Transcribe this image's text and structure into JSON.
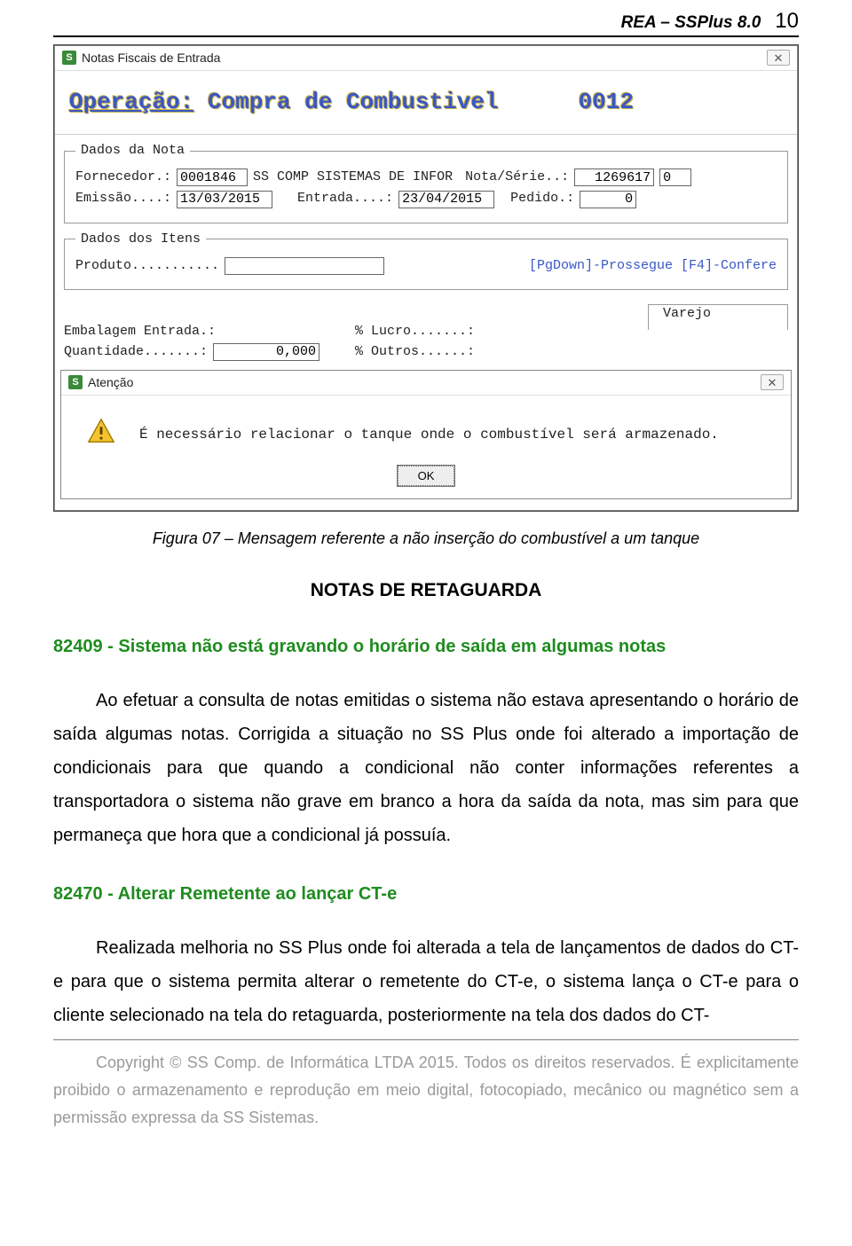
{
  "header": {
    "product": "REA – SSPlus 8.0",
    "page_number": "10"
  },
  "screenshot": {
    "main_window_title": "Notas Fiscais de Entrada",
    "close_glyph": "✕",
    "banner_op_label": "Operação:",
    "banner_op_value": "Compra de Combustivel",
    "banner_code": "0012",
    "group_nota": {
      "legend": "Dados da Nota",
      "fornecedor_label": "Fornecedor.:",
      "fornecedor_code": "0001846",
      "fornecedor_name": "SS COMP SISTEMAS DE INFOR",
      "nota_serie_label": "Nota/Série..:",
      "nota_value": "1269617",
      "serie_value": "0",
      "emissao_label": "Emissão....:",
      "emissao_value": "13/03/2015",
      "entrada_label": "Entrada....:",
      "entrada_value": "23/04/2015",
      "pedido_label": "Pedido.:",
      "pedido_value": "0"
    },
    "group_itens": {
      "legend": "Dados dos Itens",
      "produto_label": "Produto...........",
      "produto_value": "",
      "hints": "[PgDown]-Prossegue  [F4]-Confere"
    },
    "varejo_label": "Varejo",
    "fields2": {
      "embalagem_label": "Embalagem Entrada.:",
      "quantidade_label": "Quantidade.......:",
      "quantidade_value": "0,000",
      "lucro_label": "% Lucro.......:",
      "outros_label": "% Outros......:"
    },
    "dialog": {
      "title": "Atenção",
      "message": "É necessário relacionar o tanque onde o combustível será armazenado.",
      "ok": "OK"
    }
  },
  "caption": "Figura 07 – Mensagem referente a não inserção do combustível a um tanque",
  "section_title": "NOTAS DE RETAGUARDA",
  "item1": {
    "heading": "82409 - Sistema não está gravando o horário de saída em algumas notas",
    "body": "Ao efetuar a consulta de notas emitidas o sistema não estava apresentando o horário de saída algumas notas. Corrigida a situação no SS Plus onde foi alterado a importação de condicionais para que quando a condicional não conter informações referentes a transportadora o sistema não grave em branco a hora da saída da nota, mas sim para que permaneça que hora que a condicional já possuía."
  },
  "item2": {
    "heading": "82470 - Alterar Remetente ao lançar CT-e",
    "body": "Realizada melhoria no SS Plus onde foi alterada a tela de lançamentos de dados do CT-e para que o sistema permita alterar o remetente do CT-e, o sistema lança o CT-e para o cliente selecionado na tela do retaguarda, posteriormente na tela dos dados do CT-"
  },
  "footer": "Copyright © SS Comp. de Informática LTDA 2015. Todos os direitos reservados. É explicitamente proibido o armazenamento e reprodução em meio digital, fotocopiado, mecânico ou magnético sem a permissão expressa da SS Sistemas."
}
